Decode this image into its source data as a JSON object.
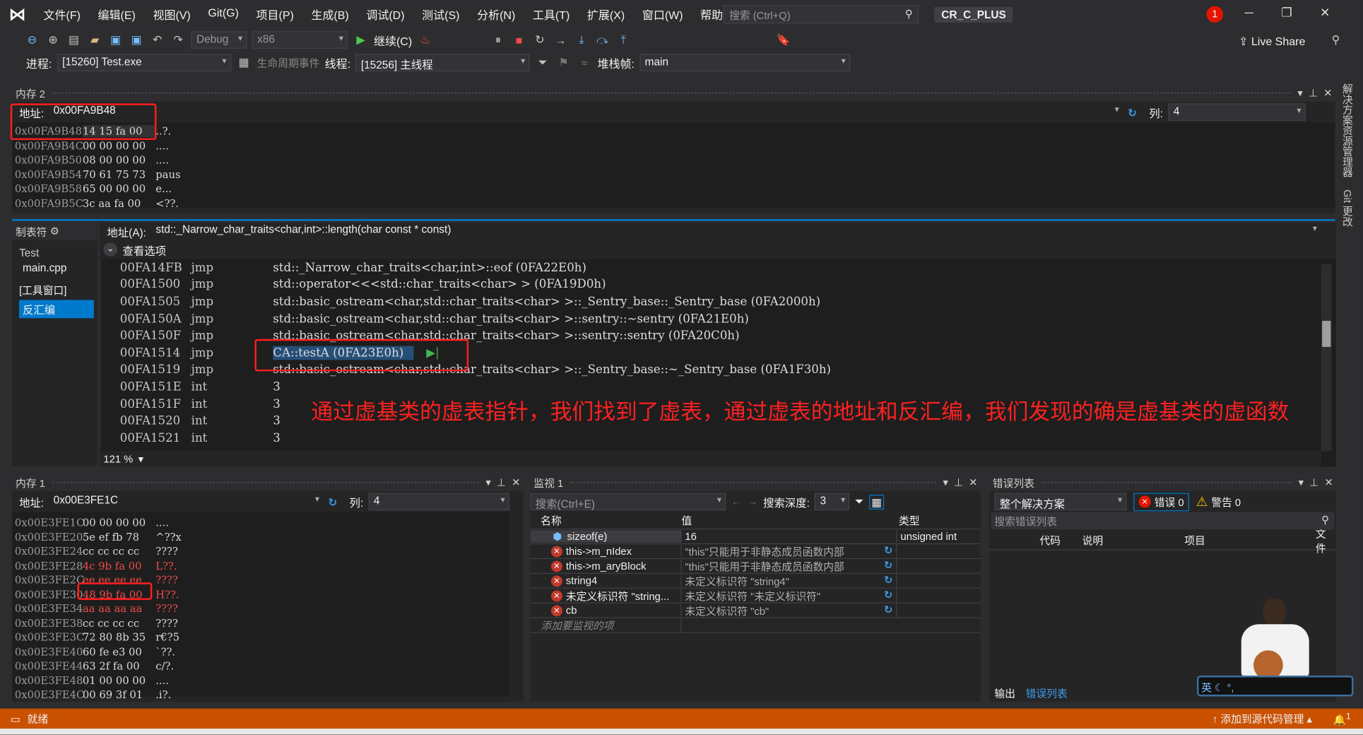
{
  "menu": [
    "文件(F)",
    "编辑(E)",
    "视图(V)",
    "Git(G)",
    "项目(P)",
    "生成(B)",
    "调试(D)",
    "测试(S)",
    "分析(N)",
    "工具(T)",
    "扩展(X)",
    "窗口(W)",
    "帮助(H)"
  ],
  "search_placeholder": "搜索 (Ctrl+Q)",
  "solution_name": "CR_C_PLUS",
  "notification_count": "1",
  "live_share": "Live Share",
  "toolbar": {
    "config": "Debug",
    "platform": "x86",
    "continue": "继续(C)",
    "process_label": "进程:",
    "process": "[15260] Test.exe",
    "lifecycle": "生命周期事件",
    "thread_label": "线程:",
    "thread": "[15256] 主线程",
    "stack_label": "堆栈帧:",
    "stack": "main"
  },
  "memory2": {
    "title": "内存 2",
    "addr_label": "地址:",
    "address": "0x00FA9B48",
    "col_label": "列:",
    "cols": "4",
    "rows": [
      [
        "0x00FA9B48",
        "14 15 fa 00",
        "..?."
      ],
      [
        "0x00FA9B4C",
        "00 00 00 00",
        "...."
      ],
      [
        "0x00FA9B50",
        "08 00 00 00",
        "...."
      ],
      [
        "0x00FA9B54",
        "70 61 75 73",
        "paus"
      ],
      [
        "0x00FA9B58",
        "65 00 00 00",
        "e..."
      ],
      [
        "0x00FA9B5C",
        "3c aa fa 00",
        "<??."
      ]
    ]
  },
  "tabs_panel": {
    "title": "制表符",
    "project": "Test",
    "file": "main.cpp",
    "group": "[工具窗口]",
    "selected": "反汇编"
  },
  "disasm": {
    "addr_label": "地址(A):",
    "address": "std::_Narrow_char_traits<char,int>::length(char const * const)",
    "view_options": "查看选项",
    "zoom": "121 %",
    "rows": [
      [
        "00FA14FB",
        "jmp",
        "std::_Narrow_char_traits<char,int>::eof (0FA22E0h)"
      ],
      [
        "00FA1500",
        "jmp",
        "std::operator<<<std::char_traits<char> > (0FA19D0h)"
      ],
      [
        "00FA1505",
        "jmp",
        "std::basic_ostream<char,std::char_traits<char> >::_Sentry_base::_Sentry_base (0FA2000h)"
      ],
      [
        "00FA150A",
        "jmp",
        "std::basic_ostream<char,std::char_traits<char> >::sentry::~sentry (0FA21E0h)"
      ],
      [
        "00FA150F",
        "jmp",
        "std::basic_ostream<char,std::char_traits<char> >::sentry::sentry (0FA20C0h)"
      ],
      [
        "00FA1514",
        "jmp",
        "CA::testA (0FA23E0h)"
      ],
      [
        "00FA1519",
        "jmp",
        "std::basic_ostream<char,std::char_traits<char> >::_Sentry_base::~_Sentry_base (0FA1F30h)"
      ],
      [
        "00FA151E",
        "int",
        "3"
      ],
      [
        "00FA151F",
        "int",
        "3"
      ],
      [
        "00FA1520",
        "int",
        "3"
      ],
      [
        "00FA1521",
        "int",
        "3"
      ]
    ]
  },
  "annotation": "通过虚基类的虚表指针，我们找到了虚表，通过虚表的地址和反汇编，我们发现的确是虚基类的虚函数",
  "memory1": {
    "title": "内存 1",
    "addr_label": "地址:",
    "address": "0x00E3FE1C",
    "col_label": "列:",
    "cols": "4",
    "rows": [
      [
        "0x00E3FE1C",
        "00 00 00 00",
        "....",
        false
      ],
      [
        "0x00E3FE20",
        "5e ef fb 78",
        "^??x",
        false
      ],
      [
        "0x00E3FE24",
        "cc cc cc cc",
        "????",
        false
      ],
      [
        "0x00E3FE28",
        "4c 9b fa 00",
        "L??.",
        true
      ],
      [
        "0x00E3FE2C",
        "ee ee ee ee",
        "????",
        true
      ],
      [
        "0x00E3FE30",
        "48 9b fa 00",
        "H??.",
        true
      ],
      [
        "0x00E3FE34",
        "aa aa aa aa",
        "????",
        true
      ],
      [
        "0x00E3FE38",
        "cc cc cc cc",
        "????",
        false
      ],
      [
        "0x00E3FE3C",
        "72 80 8b 35",
        "r€?5",
        false
      ],
      [
        "0x00E3FE40",
        "60 fe e3 00",
        "`??.",
        false
      ],
      [
        "0x00E3FE44",
        "63 2f fa 00",
        "c/?.",
        false
      ],
      [
        "0x00E3FE48",
        "01 00 00 00",
        "....",
        false
      ],
      [
        "0x00E3FE4C",
        "00 69 3f 01",
        ".i?.",
        false
      ]
    ]
  },
  "watch": {
    "title": "监视 1",
    "search_placeholder": "搜索(Ctrl+E)",
    "depth_label": "搜索深度:",
    "depth": "3",
    "headers": [
      "名称",
      "值",
      "类型"
    ],
    "rows": [
      [
        "sizeof(e)",
        "16",
        "unsigned int",
        false
      ],
      [
        "this->m_nIdex",
        "\"this\"只能用于非静态成员函数内部",
        "",
        true
      ],
      [
        "this->m_aryBlock",
        "\"this\"只能用于非静态成员函数内部",
        "",
        true
      ],
      [
        "string4",
        "未定义标识符 \"string4\"",
        "",
        true
      ],
      [
        "未定义标识符 \"string...",
        "未定义标识符 \"未定义标识符\"",
        "",
        true
      ],
      [
        "cb",
        "未定义标识符 \"cb\"",
        "",
        true
      ]
    ],
    "add_item": "添加要监视的项"
  },
  "errors": {
    "title": "错误列表",
    "scope": "整个解决方案",
    "errors": "错误 0",
    "warnings": "警告 0",
    "search_placeholder": "搜索错误列表",
    "headers": [
      "代码",
      "说明",
      "项目",
      "文件"
    ],
    "tabs": [
      "输出",
      "错误列表"
    ]
  },
  "side_tabs": [
    "解决方案资源管理器",
    "Git 更改"
  ],
  "status": {
    "ready": "就绪",
    "source_control": "添加到源代码管理",
    "notif": "1"
  },
  "colors": {
    "accent": "#007acc",
    "status_bar": "#ca5100",
    "highlight": "#ff1f1f"
  }
}
